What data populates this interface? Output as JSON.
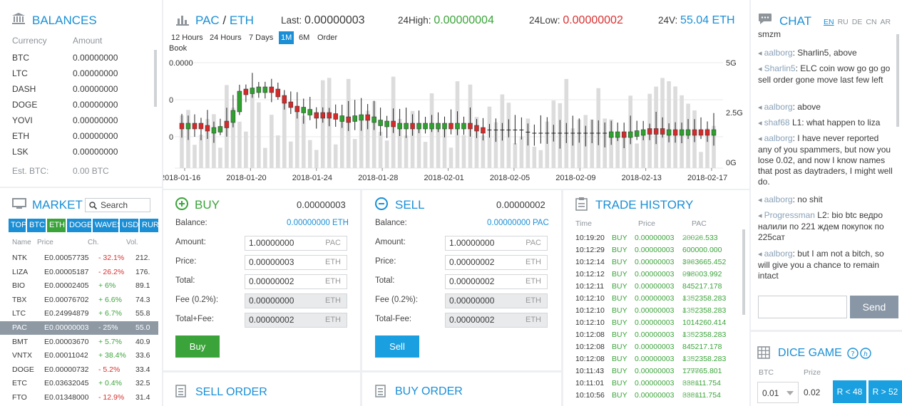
{
  "balances": {
    "title": "BALANCES",
    "col_currency": "Currency",
    "col_amount": "Amount",
    "rows": [
      {
        "cur": "BTC",
        "amt": "0.00000000"
      },
      {
        "cur": "LTC",
        "amt": "0.00000000"
      },
      {
        "cur": "DASH",
        "amt": "0.00000000"
      },
      {
        "cur": "DOGE",
        "amt": "0.00000000"
      },
      {
        "cur": "YOVI",
        "amt": "0.00000000"
      },
      {
        "cur": "ETH",
        "amt": "0.00000000"
      },
      {
        "cur": "LSK",
        "amt": "0.00000000"
      }
    ],
    "est_label": "Est. BTC:",
    "est_value": "0.00 BTC"
  },
  "market": {
    "title": "MARKET",
    "search_placeholder": "Search",
    "tabs": [
      "TOP",
      "BTC",
      "ETH",
      "DOGE",
      "WAVES",
      "USD",
      "RUR"
    ],
    "active_tab": "ETH",
    "col_name": "Name",
    "col_price": "Price",
    "col_change": "Ch.",
    "col_vol": "Vol.",
    "rows": [
      {
        "name": "NTK",
        "price": "E0.00057735",
        "ch": "- 32.1%",
        "dir": "down",
        "vol": "212."
      },
      {
        "name": "LIZA",
        "price": "E0.00005187",
        "ch": "- 26.2%",
        "dir": "down",
        "vol": "176."
      },
      {
        "name": "BIO",
        "price": "E0.00002405",
        "ch": "+ 6%",
        "dir": "up",
        "vol": "89.1"
      },
      {
        "name": "TBX",
        "price": "E0.00076702",
        "ch": "+ 6.6%",
        "dir": "up",
        "vol": "74.3"
      },
      {
        "name": "LTC",
        "price": "E0.24994879",
        "ch": "+ 6.7%",
        "dir": "up",
        "vol": "55.8"
      },
      {
        "name": "PAC",
        "price": "E0.00000003",
        "ch": "- 25%",
        "dir": "down",
        "vol": "55.0",
        "selected": true
      },
      {
        "name": "BMT",
        "price": "E0.00003670",
        "ch": "+ 5.7%",
        "dir": "up",
        "vol": "40.9"
      },
      {
        "name": "VNTX",
        "price": "E0.00011042",
        "ch": "+ 38.4%",
        "dir": "up",
        "vol": "33.6"
      },
      {
        "name": "DOGE",
        "price": "E0.00000732",
        "ch": "- 5.2%",
        "dir": "down",
        "vol": "33.4"
      },
      {
        "name": "ETC",
        "price": "E0.03632045",
        "ch": "+ 0.4%",
        "dir": "up",
        "vol": "32.5"
      },
      {
        "name": "FTO",
        "price": "E0.01348000",
        "ch": "- 12.9%",
        "dir": "down",
        "vol": "31.4"
      }
    ]
  },
  "ticker": {
    "pair_base": "PAC",
    "pair_sep": " / ",
    "pair_quote": "ETH",
    "last_label": "Last:",
    "last_value": "0.00000003",
    "high_label": "24High:",
    "high_value": "0.00000004",
    "low_label": "24Low:",
    "low_value": "0.00000002",
    "vol_label": "24V:",
    "vol_value": "55.04 ETH"
  },
  "timeframes": [
    "12 Hours",
    "24 Hours",
    "7 Days",
    "1M",
    "6M",
    "Order"
  ],
  "timeframe_active": "1M",
  "order_book_wrap": "Book",
  "chart_data": {
    "type": "candlestick",
    "y_left_ticks": [
      "0.0000",
      "0",
      "0"
    ],
    "y_right_ticks": [
      "5G",
      "2.5G",
      "0G"
    ],
    "x_ticks": [
      "2018-01-16",
      "2018-01-20",
      "2018-01-24",
      "2018-01-28",
      "2018-02-01",
      "2018-02-05",
      "2018-02-09",
      "2018-02-13",
      "2018-02-17"
    ],
    "candle_count": 84,
    "up_color": "#2ea02e",
    "down_color": "#d42a2a",
    "volume_color": "#dcdcdc",
    "price_seed": [
      0.4,
      0.38,
      0.4,
      0.38,
      0.35,
      0.36,
      0.37,
      0.42,
      0.52,
      0.7,
      0.72,
      0.73,
      0.74,
      0.74,
      0.72,
      0.66,
      0.6,
      0.56,
      0.55,
      0.53,
      0.5,
      0.49,
      0.5,
      0.49,
      0.47,
      0.46,
      0.46,
      0.47,
      0.48,
      0.46,
      0.43,
      0.42,
      0.42,
      0.4,
      0.4,
      0.4,
      0.4,
      0.4,
      0.4,
      0.4,
      0.4,
      0.4,
      0.4,
      0.4,
      0.4,
      0.38,
      0.36,
      0.35,
      0.35,
      0.35,
      0.35,
      0.35,
      0.35,
      0.33,
      0.32,
      0.32,
      0.32,
      0.32,
      0.32,
      0.32,
      0.32,
      0.32,
      0.32,
      0.32,
      0.32,
      0.32,
      0.32,
      0.32,
      0.32,
      0.32,
      0.32,
      0.33,
      0.34,
      0.35,
      0.35,
      0.34,
      0.34,
      0.34,
      0.34,
      0.34,
      0.34,
      0.34,
      0.34,
      0.34
    ]
  },
  "buy": {
    "title": "BUY",
    "total_value": "0.00000003",
    "balance_label": "Balance:",
    "balance_value": "0.00000000 ETH",
    "amount_label": "Amount:",
    "amount_value": "1.00000000",
    "amount_unit": "PAC",
    "price_label": "Price:",
    "price_value": "0.00000003",
    "price_unit": "ETH",
    "total_label": "Total:",
    "total_input": "0.00000002",
    "total_unit": "ETH",
    "fee_label": "Fee (0.2%):",
    "fee_value": "0.00000000",
    "fee_unit": "ETH",
    "tf_label": "Total+Fee:",
    "tf_value": "0.00000002",
    "tf_unit": "ETH",
    "button": "Buy"
  },
  "sell": {
    "title": "SELL",
    "total_value": "0.00000002",
    "balance_label": "Balance:",
    "balance_value": "0.00000000 PAC",
    "amount_label": "Amount:",
    "amount_value": "1.00000000",
    "amount_unit": "PAC",
    "price_label": "Price:",
    "price_value": "0.00000002",
    "price_unit": "ETH",
    "total_label": "Total:",
    "total_input": "0.00000002",
    "total_unit": "ETH",
    "fee_label": "Fee (0.2%):",
    "fee_value": "0.00000000",
    "fee_unit": "ETH",
    "tf_label": "Total-Fee:",
    "tf_value": "0.00000002",
    "tf_unit": "ETH",
    "button": "Sell"
  },
  "trade_history": {
    "title": "TRADE HISTORY",
    "col_time": "Time",
    "col_price": "Price",
    "col_pac": "PAC",
    "rows": [
      {
        "time": "10:19:20",
        "type": "BUY",
        "price": "0.00000003",
        "pac": "20026.533",
        "pac_tail": "33333"
      },
      {
        "time": "10:12:29",
        "type": "BUY",
        "price": "0.00000003",
        "pac": "600000.000",
        "pac_tail": ""
      },
      {
        "time": "10:12:14",
        "type": "BUY",
        "price": "0.00000003",
        "pac": "3963665.452",
        "pac_tail": "469"
      },
      {
        "time": "10:12:12",
        "type": "BUY",
        "price": "0.00000003",
        "pac": "998003.992",
        "pac_tail": "0159"
      },
      {
        "time": "10:12:11",
        "type": "BUY",
        "price": "0.00000003",
        "pac": "845217.178",
        "pac_tail": ""
      },
      {
        "time": "10:12:10",
        "type": "BUY",
        "price": "0.00000003",
        "pac": "1352358.283",
        "pac_tail": "433"
      },
      {
        "time": "10:12:10",
        "type": "BUY",
        "price": "0.00000003",
        "pac": "1352358.283",
        "pac_tail": "433"
      },
      {
        "time": "10:12:10",
        "type": "BUY",
        "price": "0.00000003",
        "pac": "1014260.414",
        "pac_tail": ""
      },
      {
        "time": "10:12:08",
        "type": "BUY",
        "price": "0.00000003",
        "pac": "1352358.283",
        "pac_tail": "433"
      },
      {
        "time": "10:12:08",
        "type": "BUY",
        "price": "0.00000003",
        "pac": "845217.178",
        "pac_tail": ""
      },
      {
        "time": "10:12:08",
        "type": "BUY",
        "price": "0.00000003",
        "pac": "1352358.283",
        "pac_tail": "433"
      },
      {
        "time": "10:11:43",
        "type": "BUY",
        "price": "0.00000003",
        "pac": "177765.801",
        "pac_tail": "7298"
      },
      {
        "time": "10:11:01",
        "type": "BUY",
        "price": "0.00000003",
        "pac": "338111.754",
        "pac_tail": "6666"
      },
      {
        "time": "10:10:56",
        "type": "BUY",
        "price": "0.00000003",
        "pac": "338111.754",
        "pac_tail": "6666"
      }
    ]
  },
  "sell_order": {
    "title": "SELL ORDER"
  },
  "buy_order": {
    "title": "BUY ORDER"
  },
  "chat": {
    "title": "CHAT",
    "langs": [
      "EN",
      "RU",
      "DE",
      "CN",
      "AR"
    ],
    "active_lang": "EN",
    "top_fragment": "smzm",
    "messages": [
      {
        "name": "aalborg",
        "sep": ": ",
        "text": "Sharlin5, above"
      },
      {
        "name": "Sharlin5",
        "sep": ": ",
        "text": "ELC coin wow go go go sell order gone move last few left"
      },
      {
        "name": "aalborg",
        "sep": ": ",
        "text": "above"
      },
      {
        "name": "shaf68",
        "sep": " ",
        "text": "L1: what happen to liza"
      },
      {
        "name": "aalborg",
        "sep": ": ",
        "text": "I have never reported any of you spammers, but now you lose 0.02, and now I know names that post as daytraders, I might well do."
      },
      {
        "name": "aalborg",
        "sep": ": ",
        "text": "no shit"
      },
      {
        "name": "Progressman",
        "sep": " ",
        "text": "L2: bio btc ведро налили по 221 ждем покупок по 225сат"
      },
      {
        "name": "aalborg",
        "sep": ": ",
        "text": "but I am not a bitch, so will give you a chance to remain intact"
      }
    ],
    "send_button": "Send"
  },
  "dice": {
    "title": "DICE GAME",
    "col_btc": "BTC",
    "col_prize": "Prize",
    "btc_value": "0.01",
    "prize_value": "0.02",
    "btn_low": "R < 48",
    "btn_high": "R > 52"
  }
}
